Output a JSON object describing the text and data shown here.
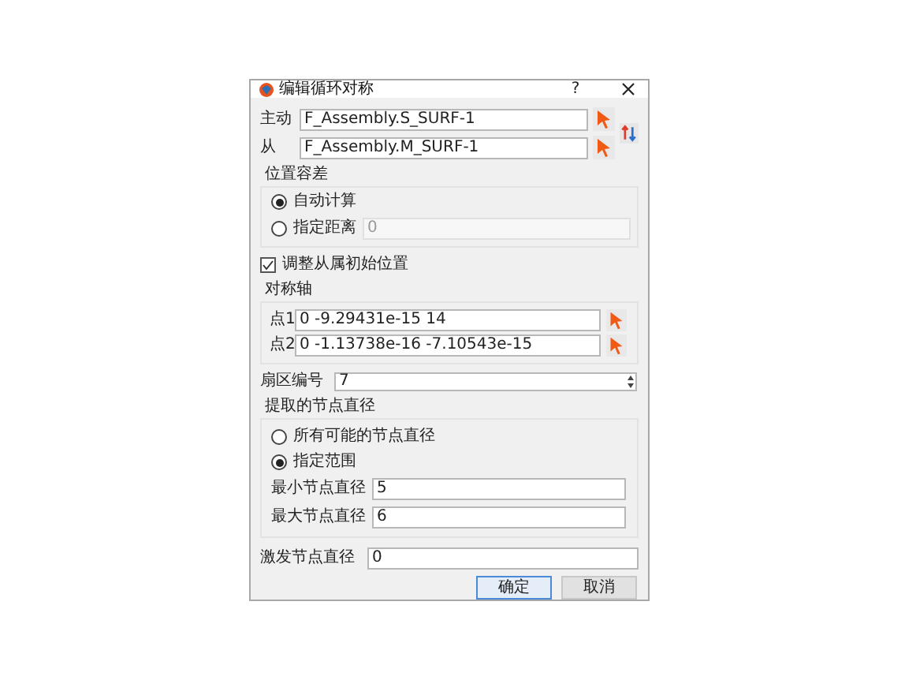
{
  "window": {
    "title": "编辑循环对称",
    "help": "?"
  },
  "surfaces": [
    {
      "label": "主动",
      "value": "F_Assembly.S_SURF-1"
    },
    {
      "label": "从",
      "value": "F_Assembly.M_SURF-1"
    }
  ],
  "position_tolerance": {
    "title": "位置容差",
    "options": [
      {
        "label": "自动计算",
        "selected": true
      },
      {
        "label": "指定距离",
        "selected": false
      }
    ],
    "distance_field": {
      "value": "0",
      "disabled": true
    }
  },
  "adjust_initial_position": {
    "label": "调整从属初始位置",
    "checked": true
  },
  "symmetry_axis": {
    "title": "对称轴",
    "points": [
      {
        "label": "点1",
        "value": "0 -9.29431e-15 14"
      },
      {
        "label": "点2",
        "value": "0 -1.13738e-16 -7.10543e-15"
      }
    ]
  },
  "sector_number": {
    "label": "扇区编号",
    "value": "7"
  },
  "nodal_diameters": {
    "title": "提取的节点直径",
    "options": [
      {
        "label": "所有可能的节点直径",
        "selected": false
      },
      {
        "label": "指定范围",
        "selected": true
      }
    ],
    "fields": [
      {
        "label": "最小节点直径",
        "value": "5"
      },
      {
        "label": "最大节点直径",
        "value": "6"
      }
    ]
  },
  "excitation_nodal_diameter": {
    "label": "激发节点直径",
    "value": "0"
  },
  "buttons": [
    {
      "label": "确定",
      "kind": "primary"
    },
    {
      "label": "取消",
      "kind": "secondary"
    }
  ]
}
